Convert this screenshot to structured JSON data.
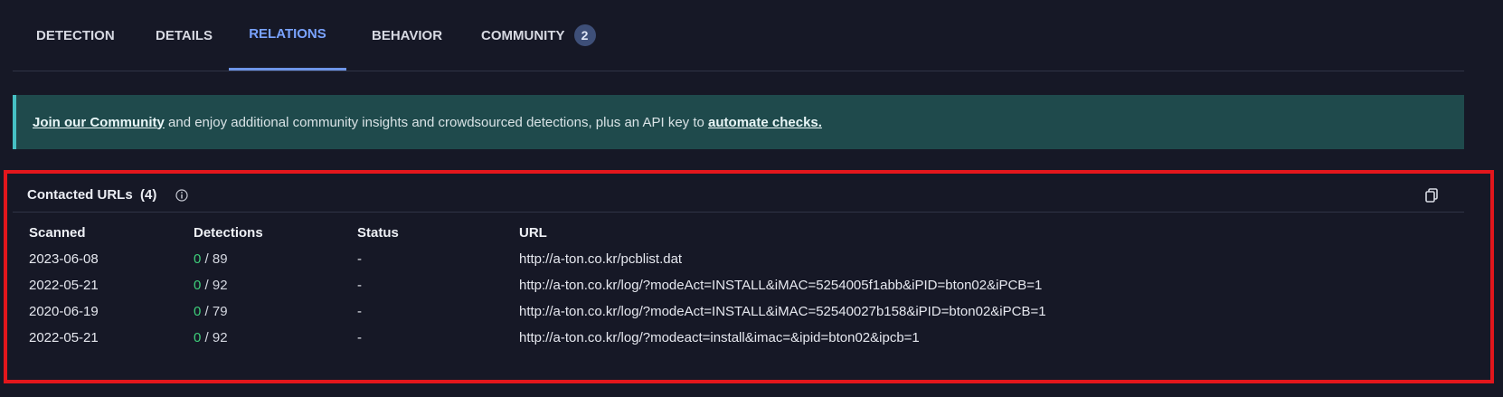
{
  "tabs": [
    {
      "label": "DETECTION"
    },
    {
      "label": "DETAILS"
    },
    {
      "label": "RELATIONS"
    },
    {
      "label": "BEHAVIOR"
    },
    {
      "label": "COMMUNITY",
      "badge": "2"
    }
  ],
  "active_tab": "RELATIONS",
  "banner": {
    "link1": "Join our Community",
    "middle": " and enjoy additional community insights and crowdsourced detections, plus an API key to ",
    "link2": "automate checks."
  },
  "contacted_urls": {
    "title": "Contacted URLs  (4)",
    "columns": [
      "Scanned",
      "Detections",
      "Status",
      "URL"
    ],
    "rows": [
      {
        "scanned": "2023-06-08",
        "det_positive": "0",
        "det_total": " / 89",
        "status": "-",
        "url": "http://a-ton.co.kr/pcblist.dat"
      },
      {
        "scanned": "2022-05-21",
        "det_positive": "0",
        "det_total": " / 92",
        "status": "-",
        "url": "http://a-ton.co.kr/log/?modeAct=INSTALL&iMAC=5254005f1abb&iPID=bton02&iPCB=1"
      },
      {
        "scanned": "2020-06-19",
        "det_positive": "0",
        "det_total": " / 79",
        "status": "-",
        "url": "http://a-ton.co.kr/log/?modeAct=INSTALL&iMAC=52540027b158&iPID=bton02&iPCB=1"
      },
      {
        "scanned": "2022-05-21",
        "det_positive": "0",
        "det_total": " / 92",
        "status": "-",
        "url": "http://a-ton.co.kr/log/?modeact=install&imac=&ipid=bton02&ipcb=1"
      }
    ]
  },
  "colors": {
    "accent": "#7aa3ff",
    "positive_zero": "#3ecf7a",
    "highlight": "#e3161c",
    "banner_bg": "#1f4a4c"
  },
  "icons": {
    "info": "info-icon",
    "copy": "copy-icon"
  }
}
